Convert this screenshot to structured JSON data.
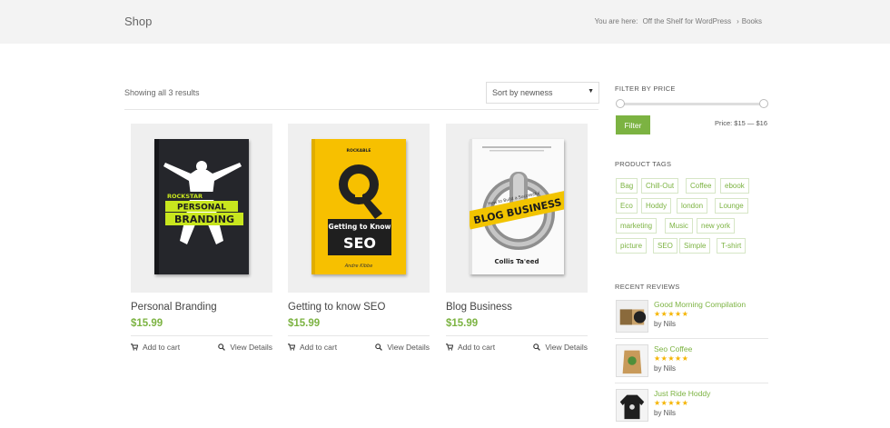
{
  "header": {
    "page_title": "Shop",
    "breadcrumb": {
      "prefix": "You are here:",
      "home": "Off the Shelf for WordPress",
      "separator": "›",
      "current": "Books"
    }
  },
  "toolbar": {
    "result_count": "Showing all 3 results",
    "sort_value": "Sort by newness"
  },
  "products": [
    {
      "name": "Personal Branding",
      "price": "$15.99",
      "add_label": "Add to cart",
      "view_label": "View Details",
      "cover": {
        "line1": "ROCKSTAR",
        "line2": "PERSONAL",
        "line3": "BRANDING"
      }
    },
    {
      "name": "Getting to know SEO",
      "price": "$15.99",
      "add_label": "Add to cart",
      "view_label": "View Details",
      "cover": {
        "top": "ROCKABLE",
        "line1": "Getting to Know",
        "line2": "SEO",
        "author": "Andre Kibbe"
      }
    },
    {
      "name": "Blog Business",
      "price": "$15.99",
      "add_label": "Add to cart",
      "view_label": "View Details",
      "cover": {
        "line1": "How to Build a Successful",
        "line2": "BLOG BUSINESS",
        "author": "Collis Ta'eed"
      }
    }
  ],
  "filter": {
    "heading": "FILTER BY PRICE",
    "button": "Filter",
    "price_range": "Price: $15 — $16"
  },
  "tags": {
    "heading": "PRODUCT TAGS",
    "items": [
      "Bag",
      "Chill-Out",
      "Coffee",
      "ebook",
      "Eco",
      "Hoddy",
      "london",
      "Lounge",
      "marketing",
      "Music",
      "new york",
      "picture",
      "SEO",
      "Simple",
      "T-shirt"
    ]
  },
  "reviews": {
    "heading": "RECENT REVIEWS",
    "items": [
      {
        "title": "Good Morning Compilation",
        "stars": "★★★★★",
        "by": "by Nils",
        "rating": 5
      },
      {
        "title": "Seo Coffee",
        "stars": "★★★★★",
        "by": "by Nils",
        "rating": 5
      },
      {
        "title": "Just Ride Hoddy",
        "stars": "★★★★★",
        "by": "by Nils",
        "rating": 5
      }
    ]
  },
  "colors": {
    "accent": "#7cb342",
    "star": "#f5b400",
    "header_bg": "#f3f3f3"
  }
}
